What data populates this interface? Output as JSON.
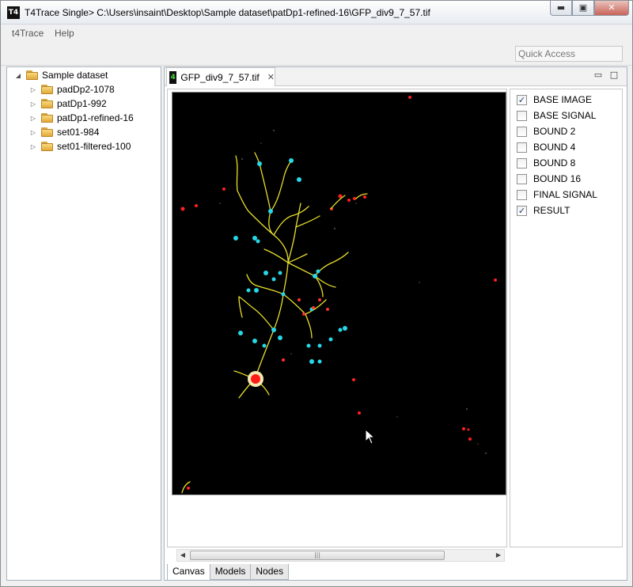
{
  "window": {
    "icon_text": "T4",
    "title": "T4Trace Single> C:\\Users\\insaint\\Desktop\\Sample dataset\\patDp1-refined-16\\GFP_div9_7_57.tif",
    "minimize_glyph": "▬",
    "maximize_glyph": "▣",
    "close_glyph": "✕"
  },
  "menu": {
    "items": [
      "t4Trace",
      "Help"
    ]
  },
  "toolbar": {
    "quick_access_placeholder": "Quick Access"
  },
  "tree": {
    "root": {
      "label": "Sample dataset",
      "arrow": "◢"
    },
    "children": [
      {
        "label": "padDp2-1078",
        "arrow": "▷"
      },
      {
        "label": "patDp1-992",
        "arrow": "▷"
      },
      {
        "label": "patDp1-refined-16",
        "arrow": "▷"
      },
      {
        "label": "set01-984",
        "arrow": "▷"
      },
      {
        "label": "set01-filtered-100",
        "arrow": "▷"
      }
    ]
  },
  "editor": {
    "tab": {
      "icon_text": "4",
      "label": "GFP_div9_7_57.tif",
      "close_glyph": "✕"
    },
    "minimize_glyph": "▭",
    "maximize_glyph": "□",
    "bottom_tabs": [
      "Canvas",
      "Models",
      "Nodes"
    ],
    "active_bottom_tab": "Canvas"
  },
  "layers": [
    {
      "label": "BASE IMAGE",
      "checked": true
    },
    {
      "label": "BASE SIGNAL",
      "checked": false
    },
    {
      "label": "BOUND 2",
      "checked": false
    },
    {
      "label": "BOUND 4",
      "checked": false
    },
    {
      "label": "BOUND 8",
      "checked": false
    },
    {
      "label": "BOUND 16",
      "checked": false
    },
    {
      "label": "FINAL SIGNAL",
      "checked": false
    },
    {
      "label": "RESULT",
      "checked": true
    }
  ],
  "colors": {
    "trace": "#e8e02a",
    "node": "#27d8e8",
    "soma": "#ff1a1a",
    "noise": "#ff2020"
  }
}
